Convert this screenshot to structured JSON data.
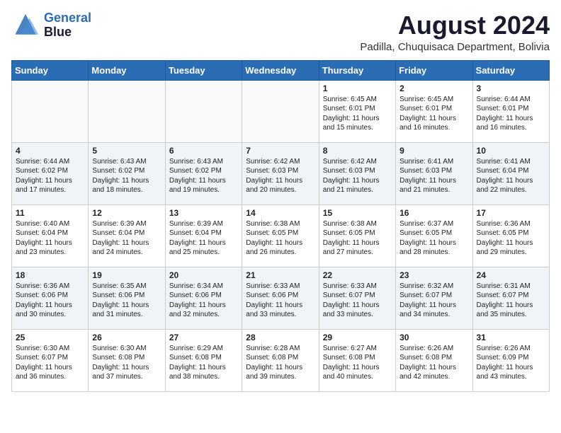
{
  "header": {
    "logo_line1": "General",
    "logo_line2": "Blue",
    "month_year": "August 2024",
    "location": "Padilla, Chuquisaca Department, Bolivia"
  },
  "weekdays": [
    "Sunday",
    "Monday",
    "Tuesday",
    "Wednesday",
    "Thursday",
    "Friday",
    "Saturday"
  ],
  "weeks": [
    [
      {
        "day": "",
        "info": ""
      },
      {
        "day": "",
        "info": ""
      },
      {
        "day": "",
        "info": ""
      },
      {
        "day": "",
        "info": ""
      },
      {
        "day": "1",
        "info": "Sunrise: 6:45 AM\nSunset: 6:01 PM\nDaylight: 11 hours\nand 15 minutes."
      },
      {
        "day": "2",
        "info": "Sunrise: 6:45 AM\nSunset: 6:01 PM\nDaylight: 11 hours\nand 16 minutes."
      },
      {
        "day": "3",
        "info": "Sunrise: 6:44 AM\nSunset: 6:01 PM\nDaylight: 11 hours\nand 16 minutes."
      }
    ],
    [
      {
        "day": "4",
        "info": "Sunrise: 6:44 AM\nSunset: 6:02 PM\nDaylight: 11 hours\nand 17 minutes."
      },
      {
        "day": "5",
        "info": "Sunrise: 6:43 AM\nSunset: 6:02 PM\nDaylight: 11 hours\nand 18 minutes."
      },
      {
        "day": "6",
        "info": "Sunrise: 6:43 AM\nSunset: 6:02 PM\nDaylight: 11 hours\nand 19 minutes."
      },
      {
        "day": "7",
        "info": "Sunrise: 6:42 AM\nSunset: 6:03 PM\nDaylight: 11 hours\nand 20 minutes."
      },
      {
        "day": "8",
        "info": "Sunrise: 6:42 AM\nSunset: 6:03 PM\nDaylight: 11 hours\nand 21 minutes."
      },
      {
        "day": "9",
        "info": "Sunrise: 6:41 AM\nSunset: 6:03 PM\nDaylight: 11 hours\nand 21 minutes."
      },
      {
        "day": "10",
        "info": "Sunrise: 6:41 AM\nSunset: 6:04 PM\nDaylight: 11 hours\nand 22 minutes."
      }
    ],
    [
      {
        "day": "11",
        "info": "Sunrise: 6:40 AM\nSunset: 6:04 PM\nDaylight: 11 hours\nand 23 minutes."
      },
      {
        "day": "12",
        "info": "Sunrise: 6:39 AM\nSunset: 6:04 PM\nDaylight: 11 hours\nand 24 minutes."
      },
      {
        "day": "13",
        "info": "Sunrise: 6:39 AM\nSunset: 6:04 PM\nDaylight: 11 hours\nand 25 minutes."
      },
      {
        "day": "14",
        "info": "Sunrise: 6:38 AM\nSunset: 6:05 PM\nDaylight: 11 hours\nand 26 minutes."
      },
      {
        "day": "15",
        "info": "Sunrise: 6:38 AM\nSunset: 6:05 PM\nDaylight: 11 hours\nand 27 minutes."
      },
      {
        "day": "16",
        "info": "Sunrise: 6:37 AM\nSunset: 6:05 PM\nDaylight: 11 hours\nand 28 minutes."
      },
      {
        "day": "17",
        "info": "Sunrise: 6:36 AM\nSunset: 6:05 PM\nDaylight: 11 hours\nand 29 minutes."
      }
    ],
    [
      {
        "day": "18",
        "info": "Sunrise: 6:36 AM\nSunset: 6:06 PM\nDaylight: 11 hours\nand 30 minutes."
      },
      {
        "day": "19",
        "info": "Sunrise: 6:35 AM\nSunset: 6:06 PM\nDaylight: 11 hours\nand 31 minutes."
      },
      {
        "day": "20",
        "info": "Sunrise: 6:34 AM\nSunset: 6:06 PM\nDaylight: 11 hours\nand 32 minutes."
      },
      {
        "day": "21",
        "info": "Sunrise: 6:33 AM\nSunset: 6:06 PM\nDaylight: 11 hours\nand 33 minutes."
      },
      {
        "day": "22",
        "info": "Sunrise: 6:33 AM\nSunset: 6:07 PM\nDaylight: 11 hours\nand 33 minutes."
      },
      {
        "day": "23",
        "info": "Sunrise: 6:32 AM\nSunset: 6:07 PM\nDaylight: 11 hours\nand 34 minutes."
      },
      {
        "day": "24",
        "info": "Sunrise: 6:31 AM\nSunset: 6:07 PM\nDaylight: 11 hours\nand 35 minutes."
      }
    ],
    [
      {
        "day": "25",
        "info": "Sunrise: 6:30 AM\nSunset: 6:07 PM\nDaylight: 11 hours\nand 36 minutes."
      },
      {
        "day": "26",
        "info": "Sunrise: 6:30 AM\nSunset: 6:08 PM\nDaylight: 11 hours\nand 37 minutes."
      },
      {
        "day": "27",
        "info": "Sunrise: 6:29 AM\nSunset: 6:08 PM\nDaylight: 11 hours\nand 38 minutes."
      },
      {
        "day": "28",
        "info": "Sunrise: 6:28 AM\nSunset: 6:08 PM\nDaylight: 11 hours\nand 39 minutes."
      },
      {
        "day": "29",
        "info": "Sunrise: 6:27 AM\nSunset: 6:08 PM\nDaylight: 11 hours\nand 40 minutes."
      },
      {
        "day": "30",
        "info": "Sunrise: 6:26 AM\nSunset: 6:08 PM\nDaylight: 11 hours\nand 42 minutes."
      },
      {
        "day": "31",
        "info": "Sunrise: 6:26 AM\nSunset: 6:09 PM\nDaylight: 11 hours\nand 43 minutes."
      }
    ]
  ]
}
